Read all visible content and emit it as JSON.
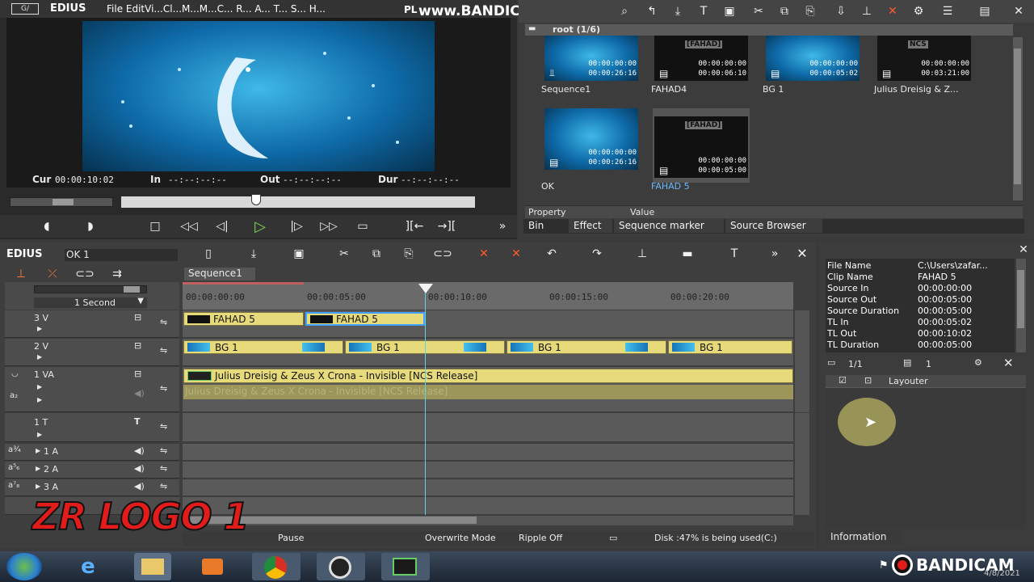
{
  "app": {
    "title": "EDIUS",
    "menu": "File EditVi...Cl...M...M...C... R... A... T... S... H...",
    "recorder_watermark": "www.BANDICAM.com",
    "pl_label": "PL"
  },
  "preview": {
    "cur_label": "Cur",
    "cur_value": "00:00:10:02",
    "in_label": "In",
    "in_value": "--:--:--:--",
    "out_label": "Out",
    "out_value": "--:--:--:--",
    "dur_label": "Dur",
    "dur_value": "--:--:--:--"
  },
  "bin": {
    "folder": "root (1/6)",
    "clips": [
      {
        "name": "Sequence1",
        "duration": "00:00:26:16",
        "start": "00:00:00:00"
      },
      {
        "name": "FAHAD4",
        "duration": "00:00:06:10",
        "start": "00:00:00:00",
        "label": "[FAHAD]"
      },
      {
        "name": "BG 1",
        "duration": "00:00:05:02",
        "start": "00:00:00:00"
      },
      {
        "name": "Julius Dreisig & Z...",
        "duration": "00:03:21:00",
        "start": "00:00:00:00",
        "label": "NCS"
      },
      {
        "name": "OK",
        "duration": "00:00:26:16",
        "start": "00:00:00:00"
      },
      {
        "name": "FAHAD 5",
        "duration": "00:00:05:00",
        "start": "00:00:00:00",
        "label": "[FAHAD]"
      }
    ],
    "property_header": "Property",
    "value_header": "Value",
    "tabs": [
      "Bin",
      "Effect",
      "Sequence marker",
      "Source Browser"
    ]
  },
  "timeline": {
    "title": "EDIUS",
    "project": "OK 1",
    "sequence_tab": "Sequence1",
    "scale": "1 Second",
    "ruler": [
      "00:00:00:00",
      "00:00:05:00",
      "00:00:10:00",
      "00:00:15:00",
      "00:00:20:00"
    ],
    "tracks": [
      {
        "name": "3 V"
      },
      {
        "name": "2 V"
      },
      {
        "name": "1 VA"
      },
      {
        "name": "1 T"
      },
      {
        "name": "1 A"
      },
      {
        "name": "2 A"
      },
      {
        "name": "3 A"
      }
    ],
    "clips_3v": [
      "FAHAD 5",
      "FAHAD 5"
    ],
    "clips_2v": [
      "BG 1",
      "BG 1",
      "BG 1",
      "BG 1"
    ],
    "clip_1va": "Julius Dreisig & Zeus X Crona - Invisible [NCS Release]",
    "clip_1va_audio": "Julius Dreisig & Zeus X Crona - Invisible [NCS Release]",
    "logo_overlay": "ZR LOGO 1"
  },
  "info": {
    "rows": [
      {
        "k": "File Name",
        "v": "C:\\Users\\zafar..."
      },
      {
        "k": "Clip Name",
        "v": "FAHAD 5"
      },
      {
        "k": "Source In",
        "v": "00:00:00:00"
      },
      {
        "k": "Source Out",
        "v": "00:00:05:00"
      },
      {
        "k": "Source Duration",
        "v": "00:00:05:00"
      },
      {
        "k": "TL In",
        "v": "00:00:05:02"
      },
      {
        "k": "TL Out",
        "v": "00:00:10:02"
      },
      {
        "k": "TL Duration",
        "v": "00:00:05:00"
      }
    ],
    "filter_count": "1/1",
    "filter_count2": "1",
    "filter_item": "Layouter",
    "tab": "Information"
  },
  "status": {
    "state": "Pause",
    "mode": "Overwrite Mode",
    "ripple": "Ripple Off",
    "disk": "Disk :47% is being used(C:)"
  },
  "taskbar": {
    "bandicam": "BANDICAM",
    "date": "4/8/2021"
  },
  "colors": {
    "accent_play": "#7ed957",
    "clip_yellow": "#e6da7a",
    "playhead": "#5fd3e0",
    "logo_red": "#e21b1b"
  }
}
